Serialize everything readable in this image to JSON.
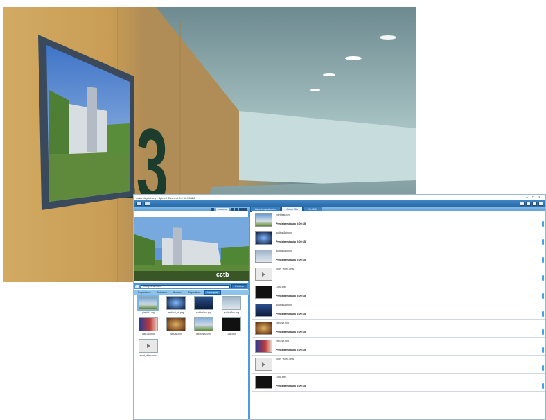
{
  "window": {
    "title": "main.playlist.org - SpineX Element 3.2.11.23426",
    "controls": [
      "–",
      "□",
      "×"
    ]
  },
  "transport": {
    "time": "0:00:00.00"
  },
  "playlist_tabs": [
    "Lista de reproducción",
    "Actual: 30fs",
    "WebDAV"
  ],
  "path": {
    "value": "Recepció  ▸  main",
    "publish": "Publicar"
  },
  "library_tabs": [
    "Propiedades",
    "Biblioteca",
    "Almacén",
    "Dispositivos",
    "Navegador"
  ],
  "library_items": [
    {
      "name": "playlist1.org",
      "icon": "playlist-icon",
      "selected": true
    },
    {
      "name": "auditori_sb.png",
      "icon": "image-icon"
    },
    {
      "name": "auditori2sb.png",
      "icon": "image-icon"
    },
    {
      "name": "auditori3sb.png",
      "icon": "image-icon"
    },
    {
      "name": "cctb1sb.png",
      "icon": "image-icon"
    },
    {
      "name": "cctb2sb.png",
      "icon": "image-icon"
    },
    {
      "name": "velosmcsb.png",
      "icon": "image-icon"
    },
    {
      "name": "Logo.png",
      "icon": "image-icon"
    },
    {
      "name": "short_video.wmv",
      "icon": "video-icon"
    }
  ],
  "playlist": [
    {
      "file": "edetriesb.png",
      "duration": "Predeterminado 0:00:15",
      "icon": "image-icon"
    },
    {
      "file": "auditori1sb.png",
      "duration": "Predeterminado 0:00:15",
      "icon": "image-icon"
    },
    {
      "file": "auditori3sb.png",
      "duration": "Predeterminado 0:00:15",
      "icon": "image-icon"
    },
    {
      "file": "short_video.wmv",
      "duration": "",
      "icon": "video-icon"
    },
    {
      "file": "Logo.png",
      "duration": "Predeterminado 0:00:15",
      "icon": "image-icon"
    },
    {
      "file": "auditori2sb.png",
      "duration": "Predeterminado 0:00:15",
      "icon": "image-icon"
    },
    {
      "file": "cctb2sb.png",
      "duration": "Predeterminado 0:00:15",
      "icon": "image-icon"
    },
    {
      "file": "cctb1sb.png",
      "duration": "Predeterminado 0:00:15",
      "icon": "image-icon"
    },
    {
      "file": "short_video.wmv",
      "duration": "",
      "icon": "video-icon"
    },
    {
      "file": "Logo.png",
      "duration": "Predeterminado 0:00:15",
      "icon": "image-icon"
    }
  ],
  "colors": {
    "accent": "#4a9be0",
    "toolbar": "#2a6aa8",
    "wall": "#c79b52"
  }
}
